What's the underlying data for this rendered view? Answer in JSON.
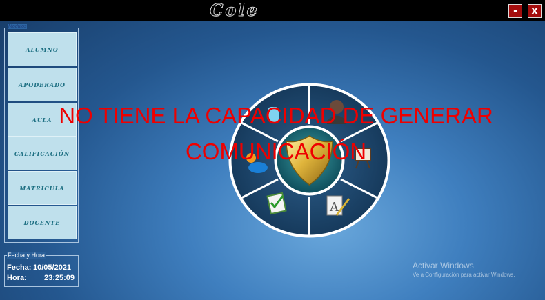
{
  "window": {
    "title": "Cole",
    "minimize_label": "-",
    "close_label": "x"
  },
  "menu": {
    "legend": "Modulos",
    "items": [
      "ALUMNO",
      "APODERADO",
      "AULA",
      "CALIFICACIÓN",
      "MATRICULA",
      "DOCENTE"
    ]
  },
  "datetime": {
    "legend": "Fecha y Hora",
    "date_label": "Fecha:",
    "date_value": "10/05/2021",
    "time_label": "Hora:",
    "time_value": "23:25:09"
  },
  "overlay": {
    "line1": "NO TIENE LA CAPACIDAD DE GENERAR",
    "line2": "COMUNICACIÓN"
  },
  "watermark": {
    "line1": "Activar Windows",
    "line2": "Ve a Configuración para activar Windows."
  },
  "wheel": {
    "segments": [
      "student",
      "teacher",
      "classroom",
      "grades",
      "enrollment",
      "guardian"
    ],
    "center_icon": "badge-shield-icon"
  },
  "colors": {
    "title_bar": "#000000",
    "window_button": "#a30d0d",
    "menu_button": "#bfe0ec",
    "menu_text": "#1d6f82",
    "overlay_text": "#ee0000"
  }
}
